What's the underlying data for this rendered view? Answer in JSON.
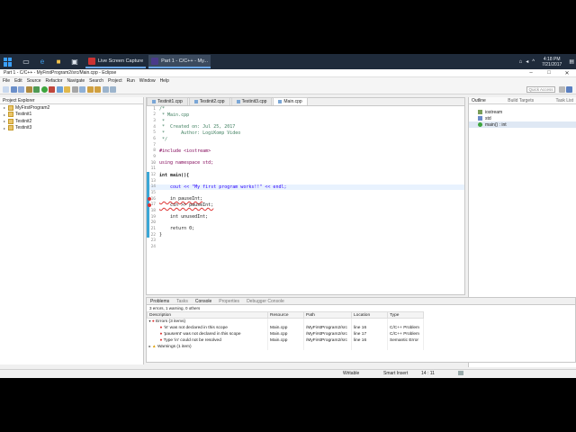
{
  "taskbar": {
    "tasks": [
      {
        "label": "Live Screen Capture"
      },
      {
        "label": "Part 1 - C/C++ - My..."
      }
    ],
    "time": "4:18 PM",
    "date": "7/21/2017"
  },
  "window": {
    "title": "Part 1 - C/C++ - MyFirstProgram2/src/Main.cpp - Eclipse"
  },
  "menu": [
    "File",
    "Edit",
    "Source",
    "Refactor",
    "Navigate",
    "Search",
    "Project",
    "Run",
    "Window",
    "Help"
  ],
  "quick_access": "Quick Access",
  "explorer": {
    "title": "Project Explorer",
    "items": [
      "MyFirstProgram2",
      "Testinit1",
      "Testinit2",
      "Testinit3"
    ]
  },
  "editor": {
    "tabs": [
      "Testinit1.cpp",
      "Testinit2.cpp",
      "Testinit3.cpp",
      "Main.cpp"
    ],
    "lines": [
      {
        "n": "1",
        "t": "/*"
      },
      {
        "n": "2",
        "t": " * Main.cpp"
      },
      {
        "n": "3",
        "t": " *"
      },
      {
        "n": "4",
        "t": " *  Created on: Jul 25, 2017"
      },
      {
        "n": "5",
        "t": " *      Author: LogiKomp Video"
      },
      {
        "n": "6",
        "t": " */"
      },
      {
        "n": "7",
        "t": ""
      },
      {
        "n": "8",
        "t": "#include <iostream>"
      },
      {
        "n": "9",
        "t": ""
      },
      {
        "n": "10",
        "t": "using namespace std;"
      },
      {
        "n": "11",
        "t": ""
      },
      {
        "n": "12",
        "t": "int main(){"
      },
      {
        "n": "13",
        "t": ""
      },
      {
        "n": "14",
        "t": "    cout << \"My first program works!!\" << endl;"
      },
      {
        "n": "15",
        "t": ""
      },
      {
        "n": "16",
        "t": "    in pauseInt;"
      },
      {
        "n": "17",
        "t": "    cin >> pauseInt;"
      },
      {
        "n": "18",
        "t": ""
      },
      {
        "n": "19",
        "t": "    int unusedInt;"
      },
      {
        "n": "20",
        "t": ""
      },
      {
        "n": "21",
        "t": "    return 0;"
      },
      {
        "n": "22",
        "t": "}"
      },
      {
        "n": "23",
        "t": ""
      },
      {
        "n": "24",
        "t": ""
      }
    ]
  },
  "outline": {
    "tabs": [
      "Outline",
      "Build Targets",
      "Task List"
    ],
    "items": [
      "iostream",
      "std",
      "main() : int"
    ]
  },
  "problems": {
    "tabs": [
      "Problems",
      "Tasks",
      "Console",
      "Properties",
      "Debugger Console"
    ],
    "summary": "3 errors, 1 warning, 0 others",
    "columns": [
      "Description",
      "Resource",
      "Path",
      "Location",
      "Type"
    ],
    "rows": [
      {
        "desc": "Errors (3 items)",
        "res": "",
        "path": "",
        "loc": "",
        "type": ""
      },
      {
        "desc": "'in' was not declared in this scope",
        "res": "Main.cpp",
        "path": "/MyFirstProgram2/src",
        "loc": "line 16",
        "type": "C/C++ Problem"
      },
      {
        "desc": "'pauseInt' was not declared in this scope",
        "res": "Main.cpp",
        "path": "/MyFirstProgram2/src",
        "loc": "line 17",
        "type": "C/C++ Problem"
      },
      {
        "desc": "Type 'in' could not be resolved",
        "res": "Main.cpp",
        "path": "/MyFirstProgram2/src",
        "loc": "line 16",
        "type": "Semantic Error"
      },
      {
        "desc": "Warnings (1 item)",
        "res": "",
        "path": "",
        "loc": "",
        "type": ""
      }
    ]
  },
  "status": {
    "mode": "Writable",
    "insert": "Smart Insert",
    "position": "14 : 11"
  }
}
